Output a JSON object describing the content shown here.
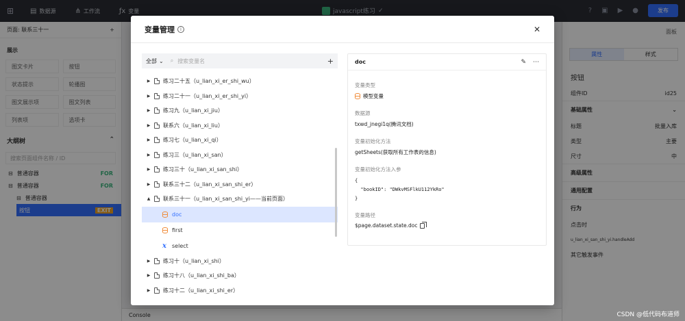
{
  "topbar": {
    "tabs": [
      {
        "icon": "database-icon",
        "label": "数据源"
      },
      {
        "icon": "workflow-icon",
        "label": "工作流"
      },
      {
        "icon": "function-icon",
        "label": "变量"
      }
    ],
    "app_title": "javascript练习",
    "publish_label": "发布"
  },
  "leftpanel": {
    "page_label": "页面: 联系三十一",
    "section_title": "展示",
    "components": [
      "图文卡片",
      "按钮",
      "状态提示",
      "轮播图",
      "图文展示项",
      "图文列表",
      "列表项",
      "选项卡"
    ],
    "outline_title": "大纲树",
    "outline_search": "搜索页面组件名称 / ID",
    "tree": [
      {
        "label": "普通容器",
        "tag": "FOR"
      },
      {
        "label": "普通容器",
        "tag": "FOR"
      },
      {
        "label": "普通容器",
        "tag": ""
      },
      {
        "label": "按钮",
        "tag": "EXIT"
      }
    ]
  },
  "rightpanel": {
    "head": "面板",
    "tabs": [
      "属性",
      "样式"
    ],
    "component_name": "按钮",
    "component_id_label": "组件ID",
    "component_id": "id25",
    "sections": {
      "basic": "基础属性",
      "advanced": "高级属性",
      "common": "通用配置",
      "behavior": "行为"
    },
    "rows": [
      {
        "label": "标题",
        "value": "批量入库"
      },
      {
        "label": "类型",
        "value": "主要"
      },
      {
        "label": "尺寸",
        "value": "中"
      }
    ],
    "event_label": "点击时",
    "event_detail": "u_lian_xi_san_shi_yi.handleAdd",
    "more_events": "其它触发事件"
  },
  "console": {
    "label": "Console"
  },
  "modal": {
    "title": "变量管理",
    "filter_label": "全部",
    "search_placeholder": "搜索变量名",
    "list": [
      {
        "label": "练习二十五（u_lian_xi_er_shi_wu）",
        "expanded": false
      },
      {
        "label": "练习二十一（u_lian_xi_er_shi_yi）",
        "expanded": false
      },
      {
        "label": "练习九（u_lian_xi_jiu）",
        "expanded": false
      },
      {
        "label": "联系六（u_lian_xi_liu）",
        "expanded": false
      },
      {
        "label": "练习七（u_lian_xi_qi）",
        "expanded": false
      },
      {
        "label": "练习三（u_lian_xi_san）",
        "expanded": false
      },
      {
        "label": "练习三十（u_lian_xi_san_shi）",
        "expanded": false
      },
      {
        "label": "联系三十二（u_lian_xi_san_shi_er）",
        "expanded": false
      },
      {
        "label": "联系三十一（u_lian_xi_san_shi_yi——当前页面）",
        "expanded": true
      }
    ],
    "children": [
      {
        "label": "doc",
        "icon": "database-icon",
        "selected": true
      },
      {
        "label": "first",
        "icon": "database-icon",
        "selected": false
      },
      {
        "label": "select",
        "icon": "variable-x-icon",
        "selected": false
      }
    ],
    "list_after": [
      {
        "label": "练习十（u_lian_xi_shi）"
      },
      {
        "label": "练习十八（u_lian_xi_shi_ba）"
      },
      {
        "label": "练习十二（u_lian_xi_shi_er）"
      }
    ],
    "detail": {
      "name": "doc",
      "type_label": "变量类型",
      "type_value": "模型变量",
      "source_label": "数据源",
      "source_value": "txwd_jnegi1q(腾讯文档)",
      "init_method_label": "变量初始化方法",
      "init_method_value": "getSheets(获取所有工作表的信息)",
      "init_params_label": "变量初始化方法入参",
      "init_params_value": "{\n  \"bookID\": \"DWkvMSFlkU112YkRo\"\n}",
      "path_label": "变量路径",
      "path_value": "$page.dataset.state.doc"
    }
  },
  "watermark": "CSDN @低代码布道师"
}
